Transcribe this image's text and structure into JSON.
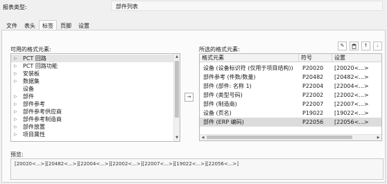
{
  "report_type": {
    "label": "报表类型:",
    "value": "部件列表"
  },
  "tabs": [
    {
      "label": "文件",
      "active": false
    },
    {
      "label": "表头",
      "active": false
    },
    {
      "label": "标签",
      "active": true
    },
    {
      "label": "页脚",
      "active": false
    },
    {
      "label": "设置",
      "active": false
    }
  ],
  "available": {
    "label": "可用的格式元素:",
    "items": [
      {
        "label": "PCT 回路",
        "expandable": true,
        "selected": true
      },
      {
        "label": "PCT 回路功能",
        "expandable": true,
        "selected": false
      },
      {
        "label": "安装板",
        "expandable": true,
        "selected": false
      },
      {
        "label": "数据集",
        "expandable": true,
        "selected": false
      },
      {
        "label": "设备",
        "expandable": false,
        "selected": false
      },
      {
        "label": "部件",
        "expandable": true,
        "selected": false
      },
      {
        "label": "部件参考",
        "expandable": true,
        "selected": false
      },
      {
        "label": "部件参考供应商",
        "expandable": true,
        "selected": false
      },
      {
        "label": "部件参考制造商",
        "expandable": true,
        "selected": false
      },
      {
        "label": "部件放置",
        "expandable": true,
        "selected": false
      },
      {
        "label": "项目属性",
        "expandable": true,
        "selected": false
      }
    ]
  },
  "add_button": {
    "icon": "arrow-right-icon",
    "glyph": "→"
  },
  "toolbar": {
    "edit_glyph": "✎",
    "delete_glyph": "🗑",
    "up_glyph": "↑",
    "down_glyph": "↓"
  },
  "selected": {
    "label": "所选的格式元素:",
    "columns": [
      "格式元素",
      "符号",
      "设置"
    ],
    "rows": [
      {
        "name": "设备 (设备标识符 (仅用于项目结构))",
        "symbol": "P20020",
        "setting": "[20020<...>",
        "selected": false
      },
      {
        "name": "部件参考 (件数/数量)",
        "symbol": "P20482",
        "setting": "[20482<...>",
        "selected": false
      },
      {
        "name": "部件 (部件: 名称 1)",
        "symbol": "P22004",
        "setting": "[22004<...>",
        "selected": false
      },
      {
        "name": "部件 (类型号码)",
        "symbol": "P22002",
        "setting": "[22002<...>",
        "selected": false
      },
      {
        "name": "部件 (制造商)",
        "symbol": "P22007",
        "setting": "[22007<...>",
        "selected": false
      },
      {
        "name": "设备 (页名)",
        "symbol": "P19022",
        "setting": "[19022<...>",
        "selected": false
      },
      {
        "name": "部件 (ERP 编码)",
        "symbol": "P22056",
        "setting": "[22056<...>",
        "selected": true
      }
    ]
  },
  "preview": {
    "label": "预览:",
    "value": "[20020<...>][20482<...>][22004<...>][22002<...>][22007<...>][19022<...>][22056<...>]"
  }
}
